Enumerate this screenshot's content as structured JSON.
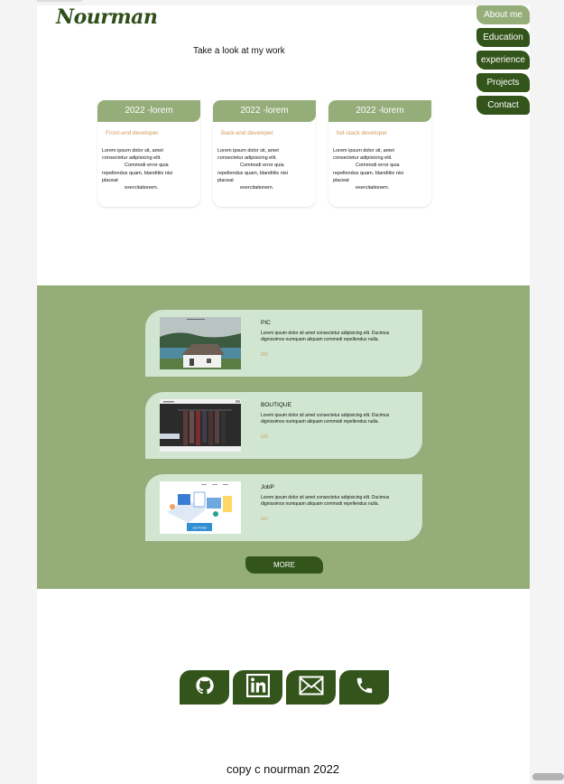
{
  "header": {
    "logo": "Nourman",
    "tagline": "Take a look at my work"
  },
  "nav": {
    "items": [
      {
        "label": "About me",
        "active": true
      },
      {
        "label": "Education",
        "active": false
      },
      {
        "label": "experience",
        "active": false
      },
      {
        "label": "Projects",
        "active": false
      },
      {
        "label": "Contact",
        "active": false
      }
    ]
  },
  "experience": {
    "cards": [
      {
        "title": "2022 -lorem",
        "role": "Front-end developer",
        "text_a": "Lorem ipsum dolor sit, amet consectetur adipisicing elit.",
        "text_b": "Commodi error quia",
        "text_c": "repellendus quam, blanditiis nisi placeat",
        "text_d": "exercitationem."
      },
      {
        "title": "2022 -lorem",
        "role": "Back-end developer",
        "text_a": "Lorem ipsum dolor sit, amet consectetur adipisicing elit.",
        "text_b": "Commodi error quia",
        "text_c": "repellendus quam, blanditiis nisi placeat",
        "text_d": "exercitationem."
      },
      {
        "title": "2022 -lorem",
        "role": "full-stack developer",
        "text_a": "Lorem ipsum dolor sit, amet consectetur adipisicing elit.",
        "text_b": "Commodi error quia",
        "text_c": "repellendus quam, blanditiis nisi placeat",
        "text_d": "exercitationem."
      }
    ]
  },
  "projects": {
    "items": [
      {
        "title": "PIC",
        "desc": "Lorem ipsum dolor sit amet consectetur adipisicing elit. Ducimus dignissimos numquam aliquam commodi repellendus nulla.",
        "link": "GO"
      },
      {
        "title": "BOUTIQUE",
        "desc": "Lorem ipsum dolor sit amet consectetur adipisicing elit. Ducimus dignissimos numquam aliquam commodi repellendus nulla.",
        "link": "GO"
      },
      {
        "title": "JobP",
        "desc": "Lorem ipsum dolor sit amet consectetur adipisicing elit. Ducimus dignissimos numquam aliquam commodi repellendus nulla.",
        "link": "GO"
      }
    ],
    "more_label": "MORE",
    "thumb_job_text": "Job Portal"
  },
  "social": {
    "icons": [
      "github-icon",
      "linkedin-icon",
      "mail-icon",
      "phone-icon"
    ]
  },
  "footer": {
    "copyright": "copy c nourman 2022"
  },
  "colors": {
    "dark_green": "#33541a",
    "sage_green": "#95ad79",
    "light_green": "#d1e6d1",
    "accent_orange": "#d29a5b"
  }
}
